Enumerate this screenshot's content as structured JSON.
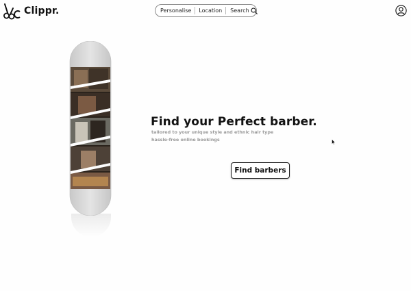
{
  "brand": {
    "name": "Clippr.",
    "logo_icon": "scissors-icon"
  },
  "nav": {
    "items": [
      {
        "label": "Personalise"
      },
      {
        "label": "Location"
      }
    ],
    "search_label": "Search",
    "search_icon": "search-icon"
  },
  "profile_icon": "user-icon",
  "hero": {
    "title": "Find your Perfect barber.",
    "subtitle_line1": "tailored to your unique style and ethnic hair type",
    "subtitle_line2": "hassle-free online bookings",
    "cta_label": "Find barbers"
  },
  "colors": {
    "text": "#121212",
    "muted": "#9a9a9a",
    "background": "#fefefe",
    "board_grey": "#d9d9d9"
  }
}
